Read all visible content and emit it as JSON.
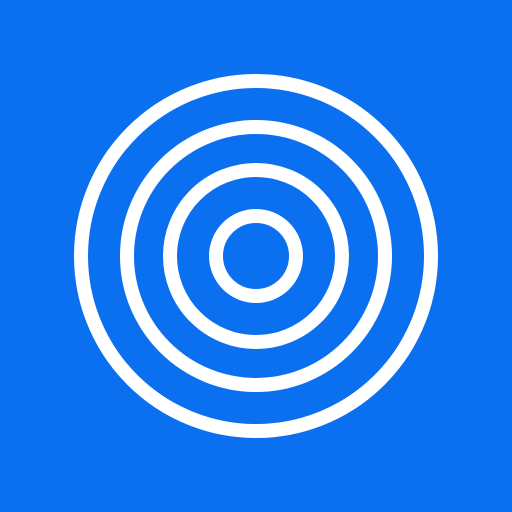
{
  "icon": {
    "name": "concentric-rings-icon",
    "background_color": "#0A70F0",
    "ring_color": "#FFFFFF"
  }
}
